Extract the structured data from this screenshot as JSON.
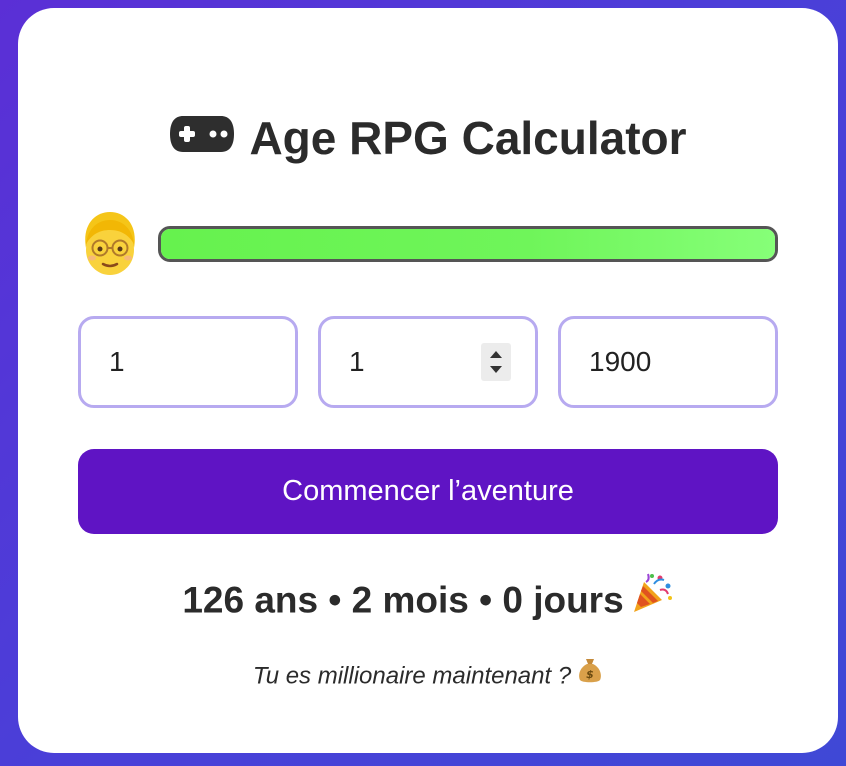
{
  "app": {
    "title": "Age RPG Calculator",
    "title_icon": "gamepad-icon"
  },
  "player": {
    "avatar_icon": "old-person-emoji",
    "hp_fraction": 1.0,
    "hp_color": "#6ff55a"
  },
  "inputs": {
    "day": "1",
    "month": "1",
    "year": "1900"
  },
  "button": {
    "label": "Commencer l’aventure",
    "color": "#5f14c4"
  },
  "result": {
    "text": "126 ans • 2 mois • 0 jours",
    "icon": "party-popper-icon"
  },
  "tagline": {
    "text": "Tu es millionaire maintenant ?",
    "icon": "money-bag-icon"
  }
}
